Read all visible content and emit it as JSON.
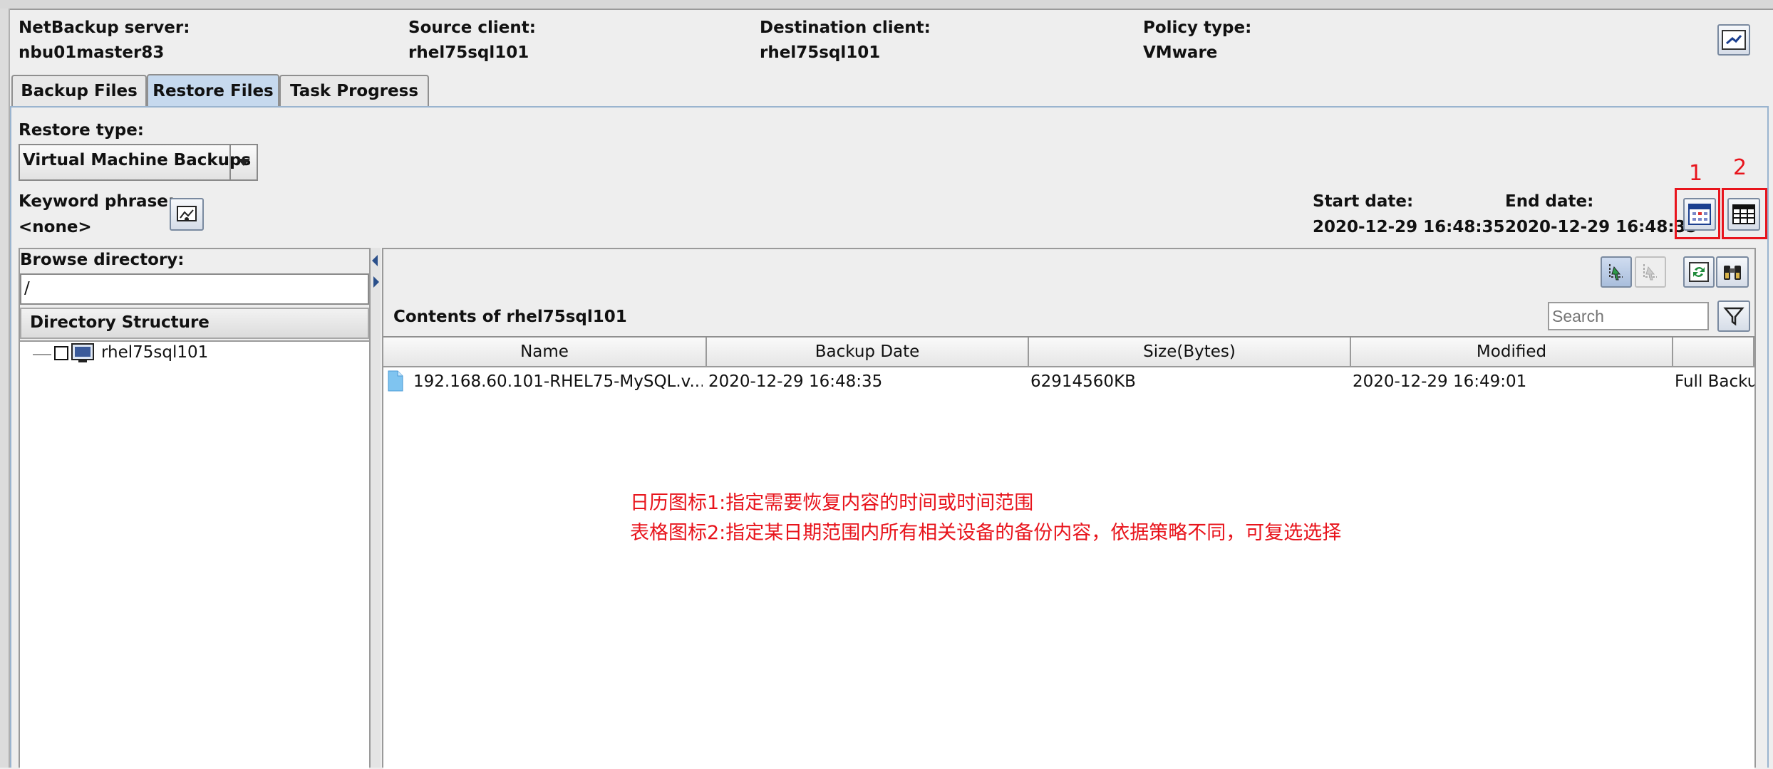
{
  "header": {
    "server_label": "NetBackup server:",
    "server_value": "nbu01master83",
    "source_label": "Source client:",
    "source_value": "rhel75sql101",
    "dest_label": "Destination client:",
    "dest_value": "rhel75sql101",
    "policy_label": "Policy type:",
    "policy_value": "VMware"
  },
  "tabs": [
    {
      "label": "Backup Files"
    },
    {
      "label": "Restore Files"
    },
    {
      "label": "Task Progress"
    }
  ],
  "restore": {
    "type_label": "Restore type:",
    "type_value": "Virtual Machine Backups",
    "keyword_label": "Keyword phrase:",
    "keyword_value": "<none>",
    "start_label": "Start date:",
    "start_value": "2020-12-29 16:48:35",
    "end_label": "End date:",
    "end_value": "2020-12-29 16:48:35"
  },
  "browse": {
    "label": "Browse directory:",
    "value": "/",
    "tree_header": "Directory Structure",
    "tree_root": "rhel75sql101"
  },
  "contents": {
    "title": "Contents of rhel75sql101",
    "search_placeholder": "Search",
    "columns": [
      "Name",
      "Backup Date",
      "Size(Bytes)",
      "Modified"
    ],
    "rows": [
      {
        "name": "192.168.60.101-RHEL75-MySQL.v...",
        "backup_date": "2020-12-29 16:48:35",
        "size": "62914560KB",
        "modified": "2020-12-29 16:49:01",
        "type": "Full Backu"
      }
    ]
  },
  "annotations": {
    "num1": "1",
    "num2": "2",
    "line1": "日历图标1:指定需要恢复内容的时间或时间范围",
    "line2": "表格图标2:指定某日期范围内所有相关设备的备份内容，依据策略不同，可复选选择",
    "color": "#e8141c"
  },
  "icons": [
    "preview-icon",
    "dropdown-arrow-icon",
    "keyword-icon",
    "calendar-icon",
    "table-icon",
    "mark-icon",
    "unmark-icon",
    "refresh-icon",
    "binoculars-icon",
    "filter-icon",
    "file-icon",
    "computer-icon",
    "checkbox-icon"
  ]
}
